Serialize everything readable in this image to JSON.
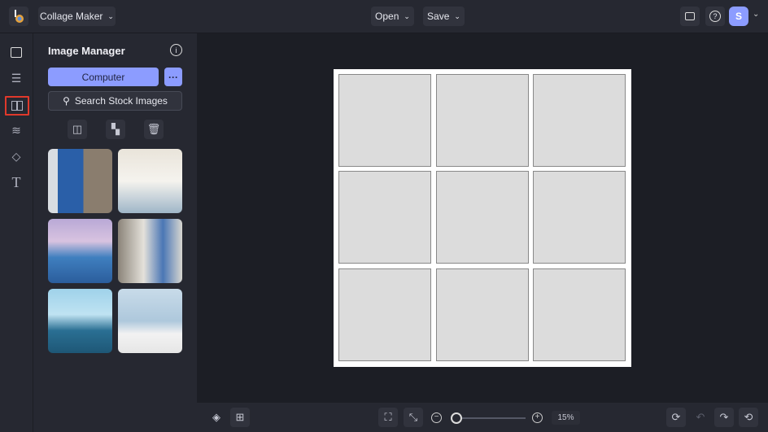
{
  "header": {
    "app_name": "Collage Maker",
    "open_label": "Open",
    "save_label": "Save",
    "avatar_initial": "S"
  },
  "panel": {
    "title": "Image Manager",
    "computer_label": "Computer",
    "more_label": "···",
    "search_label": "Search Stock Images"
  },
  "zoom": {
    "value": "15%",
    "slider_fraction": 0.05
  },
  "colors": {
    "accent": "#8c9cff",
    "highlight": "#e0392b"
  }
}
